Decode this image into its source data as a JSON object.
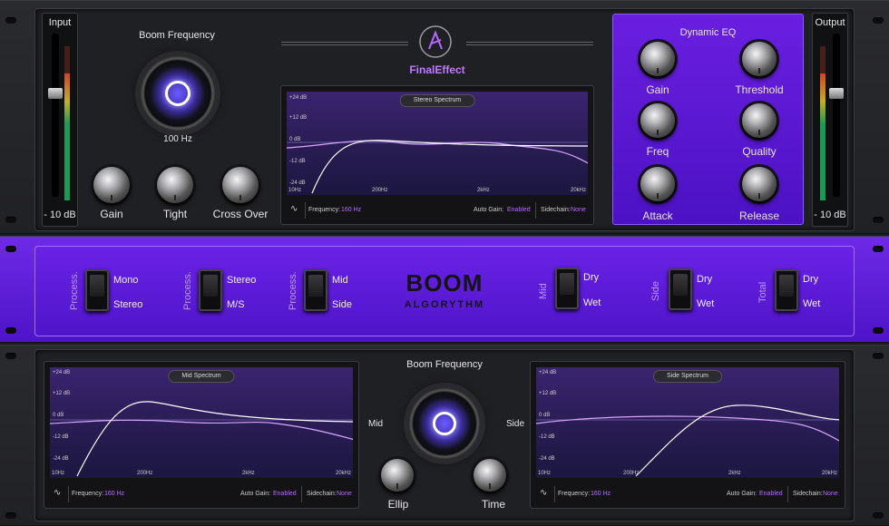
{
  "input_meter": {
    "title": "Input",
    "value": "- 10 dB"
  },
  "output_meter": {
    "title": "Output",
    "value": "- 10 dB"
  },
  "top": {
    "boom_title": "Boom Frequency",
    "boom_value": "100 Hz",
    "knobs": [
      "Gain",
      "Tight",
      "Cross Over"
    ],
    "logo": "FinalEffect"
  },
  "stereo_spectrum": {
    "title": "Stereo Spectrum",
    "y_ticks": [
      "+24 dB",
      "+12 dB",
      "0 dB",
      "-12 dB",
      "-24 dB"
    ],
    "x_ticks": [
      "10Hz",
      "200Hz",
      "2kHz",
      "20kHz"
    ],
    "frequency_label": "Frequency:",
    "frequency_value": "160 Hz",
    "autogain_label": "Auto Gain:",
    "autogain_value": "Enabled",
    "sidechain_label": "Sidechain:",
    "sidechain_value": "None"
  },
  "dynamic_eq": {
    "title": "Dynamic EQ",
    "knobs": [
      "Gain",
      "Threshold",
      "Freq",
      "Quality",
      "Attack",
      "Release"
    ]
  },
  "middle": {
    "process_label": "Process.",
    "switches": [
      {
        "top": "Mono",
        "bottom": "Stereo"
      },
      {
        "top": "Stereo",
        "bottom": "M/S"
      },
      {
        "top": "Mid",
        "bottom": "Side"
      }
    ],
    "brand_top": "BOOM",
    "brand_bottom": "ALGORYTHM",
    "mix_switches": [
      {
        "label": "Mid",
        "top": "Dry",
        "bottom": "Wet"
      },
      {
        "label": "Side",
        "top": "Dry",
        "bottom": "Wet"
      },
      {
        "label": "Total",
        "top": "Dry",
        "bottom": "Wet"
      }
    ]
  },
  "bottom": {
    "boom_title": "Boom Frequency",
    "mid_label": "Mid",
    "side_label": "Side",
    "knobs": [
      "Ellip",
      "Time"
    ],
    "mid_spectrum": {
      "title": "Mid Spectrum",
      "y_ticks": [
        "+24 dB",
        "+12 dB",
        "0 dB",
        "-12 dB",
        "-24 dB"
      ],
      "x_ticks": [
        "10Hz",
        "200Hz",
        "2kHz",
        "20kHz"
      ],
      "frequency_label": "Frequency:",
      "frequency_value": "160 Hz",
      "autogain_label": "Auto Gain:",
      "autogain_value": "Enabled",
      "sidechain_label": "Sidechain:",
      "sidechain_value": "None"
    },
    "side_spectrum": {
      "title": "Side Spectrum",
      "y_ticks": [
        "+24 dB",
        "+12 dB",
        "0 dB",
        "-12 dB",
        "-24 dB"
      ],
      "x_ticks": [
        "10Hz",
        "200Hz",
        "2kHz",
        "20kHz"
      ],
      "frequency_label": "Frequency:",
      "frequency_value": "160 Hz",
      "autogain_label": "Auto Gain:",
      "autogain_value": "Enabled",
      "sidechain_label": "Sidechain:",
      "sidechain_value": "None"
    }
  },
  "colors": {
    "accent": "#6a1fe0",
    "highlight": "#b868ff",
    "panel": "#1d1e21"
  }
}
